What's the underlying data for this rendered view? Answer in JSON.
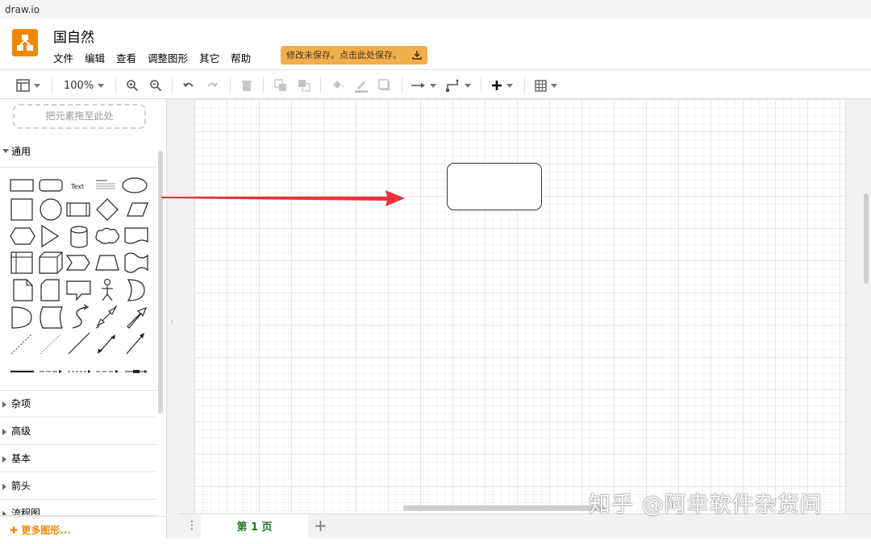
{
  "window": {
    "title": "draw.io"
  },
  "header": {
    "doc_title": "国自然",
    "menu": [
      "文件",
      "编辑",
      "查看",
      "调整图形",
      "其它",
      "帮助"
    ],
    "save_banner": "修改未保存。点击此处保存。",
    "logo_icon": "drawio-logo-icon",
    "brand_color": "#f08705"
  },
  "toolbar": {
    "zoom": "100%",
    "icons": [
      "format-panel-icon",
      "zoom-in-icon",
      "zoom-out-icon",
      "undo-icon",
      "redo-icon",
      "delete-icon",
      "to-front-icon",
      "to-back-icon",
      "fill-color-icon",
      "line-color-icon",
      "shadow-icon",
      "connection-icon",
      "waypoints-icon",
      "insert-icon",
      "table-icon"
    ]
  },
  "sidebar": {
    "drop_zone": "把元素拖至此处",
    "general_section": "通用",
    "text_shape_label": "Text",
    "sections": [
      "杂项",
      "高级",
      "基本",
      "箭头",
      "流程图"
    ],
    "more_shapes": "更多图形..."
  },
  "pagebar": {
    "page_tab": "第 1 页",
    "add_page": "+"
  },
  "overlay": {
    "arrow_color": "#e8333a",
    "watermark": "知乎 @阿幸软件杂货间"
  }
}
